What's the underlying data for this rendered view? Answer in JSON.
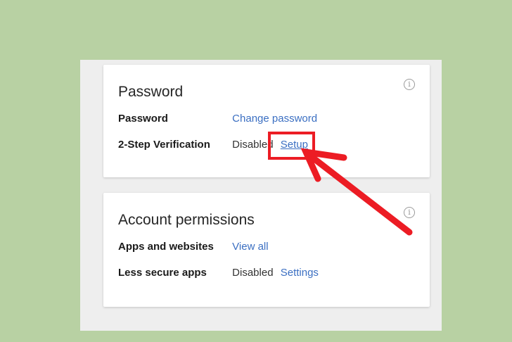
{
  "colors": {
    "background": "#b8d1a3",
    "panel": "#eeeeee",
    "link": "#3b6fc2",
    "annotation": "#ec1c24"
  },
  "password_card": {
    "title": "Password",
    "info_icon": "info-icon",
    "rows": [
      {
        "label": "Password",
        "link": "Change password"
      },
      {
        "label": "2-Step Verification",
        "status": "Disabled",
        "link": "Setup"
      }
    ]
  },
  "permissions_card": {
    "title": "Account permissions",
    "info_icon": "info-icon",
    "rows": [
      {
        "label": "Apps and websites",
        "link": "View all"
      },
      {
        "label": "Less secure apps",
        "status": "Disabled",
        "link": "Settings"
      }
    ]
  },
  "annotation": {
    "highlight": "red box around Setup link",
    "arrow": "red arrow pointing to Setup link"
  }
}
